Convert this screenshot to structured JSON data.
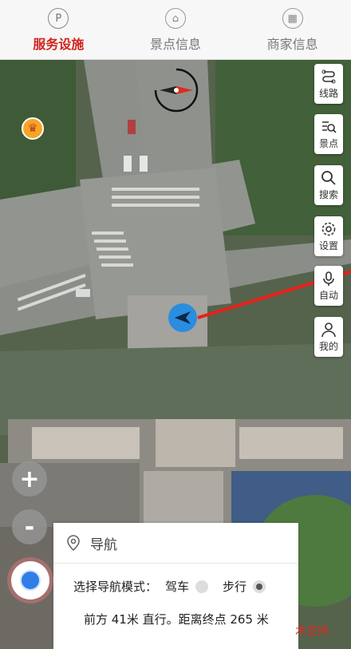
{
  "tabs": [
    {
      "label": "服务设施",
      "icon": "parking-icon",
      "glyph": "P",
      "active": true
    },
    {
      "label": "景点信息",
      "icon": "attraction-icon",
      "glyph": "⌂",
      "active": false
    },
    {
      "label": "商家信息",
      "icon": "shop-icon",
      "glyph": "▦",
      "active": false
    }
  ],
  "side_buttons": [
    {
      "label": "线路",
      "icon": "route-icon"
    },
    {
      "label": "景点",
      "icon": "spot-list-icon"
    },
    {
      "label": "搜索",
      "icon": "search-icon"
    },
    {
      "label": "设置",
      "icon": "settings-icon"
    },
    {
      "label": "自动",
      "icon": "microphone-icon"
    },
    {
      "label": "我的",
      "icon": "user-icon"
    }
  ],
  "zoom": {
    "plus": "+",
    "minus": "-"
  },
  "panel": {
    "title": "导航",
    "mode_label": "选择导航模式：",
    "drive_label": "驾车",
    "walk_label": "步行",
    "selected_mode": "walk",
    "status_text": "前方 41米 直行。距离终点 265 米"
  },
  "footer": {
    "support_text": "术支持"
  },
  "colors": {
    "accent": "#d0241c",
    "route": "#e8201a",
    "location": "#2f7fe6"
  }
}
